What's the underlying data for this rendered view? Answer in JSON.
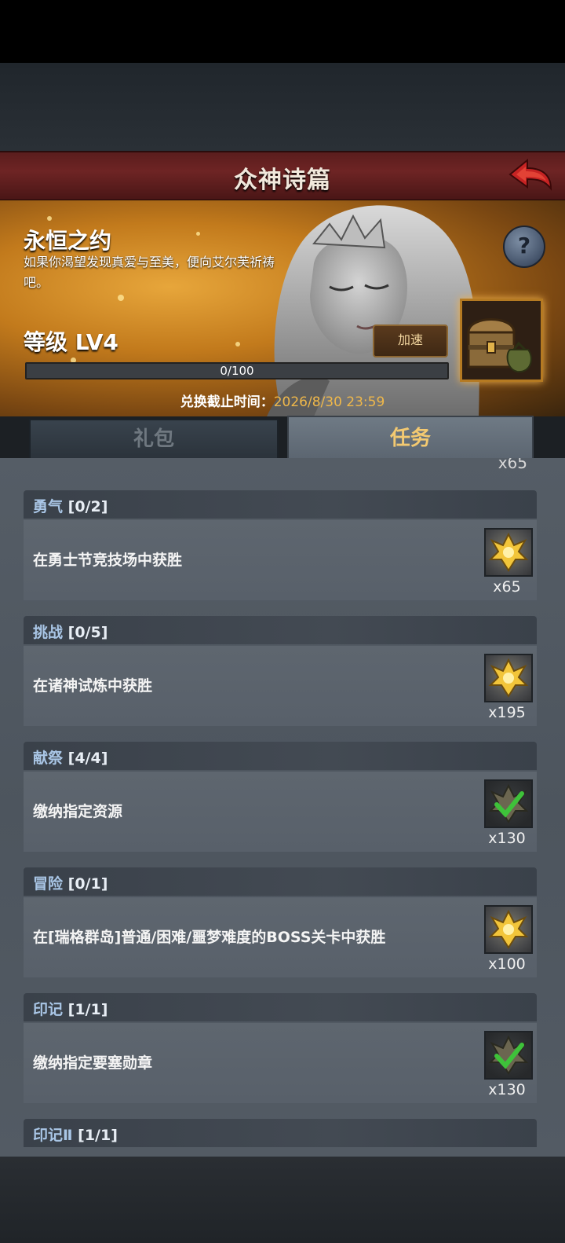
{
  "header": {
    "title": "众神诗篇"
  },
  "banner": {
    "title": "永恒之约",
    "description": "如果你渴望发现真爱与至美，便向艾尔芙祈祷吧。",
    "help_label": "?",
    "level_label": "等级 LV4",
    "speed_button_label": "加速",
    "progress": {
      "text": "0/100",
      "fraction": 0.0
    },
    "deadline_key": "兑换截止时间：",
    "deadline_value": "2026/8/30 23:59"
  },
  "tabs": [
    {
      "label": "礼包",
      "active": false
    },
    {
      "label": "任务",
      "active": true
    }
  ],
  "list": {
    "prev_reward_qty": "x65",
    "tasks": [
      {
        "category": "勇气",
        "count": "[0/2]",
        "description": "在勇士节竞技场中获胜",
        "reward_icon": "gold-emblem-icon",
        "reward_qty": "x65",
        "completed": false
      },
      {
        "category": "挑战",
        "count": "[0/5]",
        "description": "在诸神试炼中获胜",
        "reward_icon": "gold-emblem-icon",
        "reward_qty": "x195",
        "completed": false
      },
      {
        "category": "献祭",
        "count": "[4/4]",
        "description": "缴纳指定资源",
        "reward_icon": "checkmark-emblem-icon",
        "reward_qty": "x130",
        "completed": true
      },
      {
        "category": "冒险",
        "count": "[0/1]",
        "description": "在[瑞格群岛]普通/困难/噩梦难度的BOSS关卡中获胜",
        "reward_icon": "gold-emblem-icon",
        "reward_qty": "x100",
        "completed": false
      },
      {
        "category": "印记",
        "count": "[1/1]",
        "description": "缴纳指定要塞勋章",
        "reward_icon": "checkmark-emblem-icon",
        "reward_qty": "x130",
        "completed": true
      },
      {
        "category": "印记Ⅱ",
        "count": "[1/1]"
      }
    ]
  },
  "colors": {
    "accent_gold": "#f3c971",
    "title_red": "#6e2424",
    "deadline_orange": "#f0b84a"
  }
}
